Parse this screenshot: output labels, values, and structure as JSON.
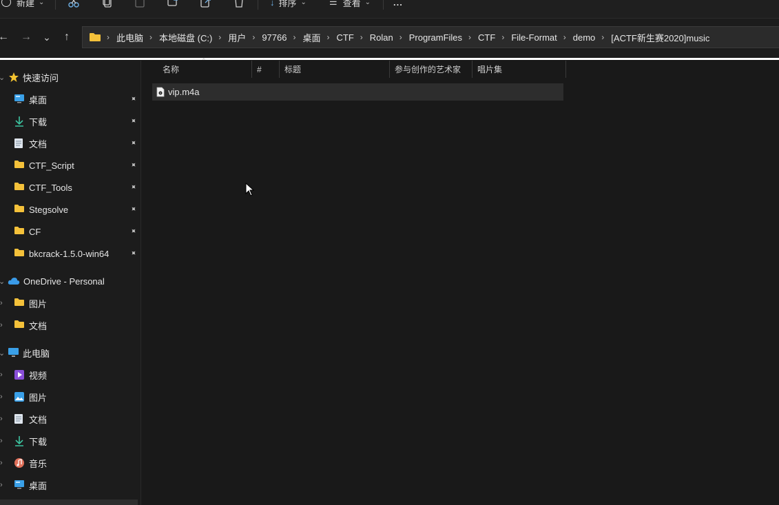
{
  "toolbar": {
    "new_label": "新建",
    "sort_label": "排序",
    "view_label": "查看",
    "more_label": "..."
  },
  "nav": {
    "back_glyph": "←",
    "forward_glyph": "→",
    "recent_glyph": "⌄",
    "up_glyph": "↑"
  },
  "breadcrumb": [
    "此电脑",
    "本地磁盘 (C:)",
    "用户",
    "97766",
    "桌面",
    "CTF",
    "Rolan",
    "ProgramFiles",
    "CTF",
    "File-Format",
    "demo",
    "[ACTF新生赛2020]music"
  ],
  "sidebar": {
    "quick_access": "快速访问",
    "pinned": [
      {
        "label": "桌面",
        "icon": "desktop-icon"
      },
      {
        "label": "下载",
        "icon": "download-icon"
      },
      {
        "label": "文档",
        "icon": "document-icon"
      },
      {
        "label": "CTF_Script",
        "icon": "folder-icon"
      },
      {
        "label": "CTF_Tools",
        "icon": "folder-icon"
      },
      {
        "label": "Stegsolve",
        "icon": "folder-icon"
      },
      {
        "label": "CF",
        "icon": "folder-icon"
      },
      {
        "label": "bkcrack-1.5.0-win64",
        "icon": "folder-icon"
      }
    ],
    "onedrive": "OneDrive - Personal",
    "onedrive_items": [
      "图片",
      "文档"
    ],
    "this_pc": "此电脑",
    "pc_items": [
      {
        "label": "视频",
        "icon": "video-icon"
      },
      {
        "label": "图片",
        "icon": "pictures-icon"
      },
      {
        "label": "文档",
        "icon": "document-icon"
      },
      {
        "label": "下载",
        "icon": "download-icon"
      },
      {
        "label": "音乐",
        "icon": "music-icon"
      },
      {
        "label": "桌面",
        "icon": "desktop-icon"
      }
    ]
  },
  "columns": {
    "name": "名称",
    "number": "#",
    "title": "标题",
    "artist": "参与创作的艺术家",
    "album": "唱片集"
  },
  "files": [
    {
      "name": "vip.m4a",
      "icon": "audio-file-icon"
    }
  ],
  "colors": {
    "background": "#191919",
    "selected_row": "#2d2d2d",
    "folder": "#f4c13a",
    "star": "#f2c230"
  }
}
